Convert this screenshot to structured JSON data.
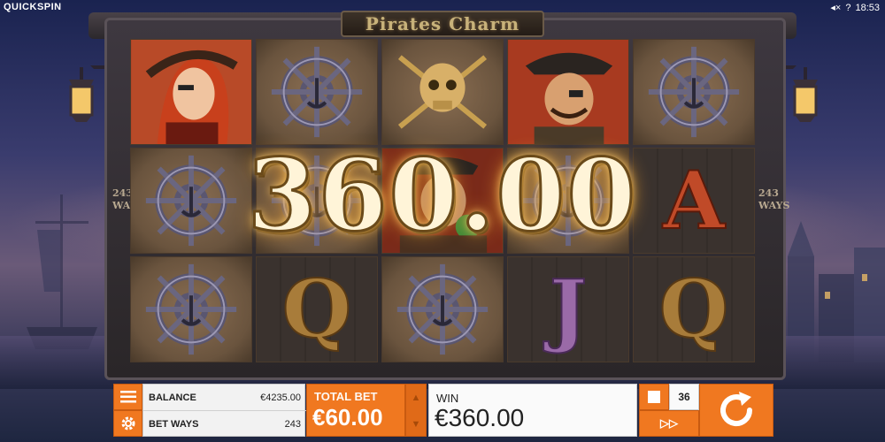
{
  "header": {
    "brand": "QUICKSPIN",
    "mute_icon": "speaker-mute-icon",
    "help": "?",
    "time": "18:53"
  },
  "game": {
    "title": "Pirates Charm",
    "ways_text": "243 WAYS",
    "big_win_amount": "360.00"
  },
  "reels": [
    [
      {
        "symbol": "pirate-lady"
      },
      {
        "symbol": "ship-wheel"
      },
      {
        "symbol": "ship-wheel"
      }
    ],
    [
      {
        "symbol": "ship-wheel"
      },
      {
        "symbol": "ship-wheel"
      },
      {
        "symbol": "Q"
      }
    ],
    [
      {
        "symbol": "skull-swords"
      },
      {
        "symbol": "pirate-parrot"
      },
      {
        "symbol": "ship-wheel"
      }
    ],
    [
      {
        "symbol": "pirate-captain"
      },
      {
        "symbol": "ship-wheel"
      },
      {
        "symbol": "J"
      }
    ],
    [
      {
        "symbol": "ship-wheel"
      },
      {
        "symbol": "A"
      },
      {
        "symbol": "Q"
      }
    ]
  ],
  "controls": {
    "menu_icon": "hamburger-menu-icon",
    "settings_icon": "gear-icon",
    "balance_label": "BALANCE",
    "balance_value": "€4235.00",
    "bet_ways_label": "BET WAYS",
    "bet_ways_value": "243",
    "total_bet_label": "TOTAL BET",
    "total_bet_value": "€60.00",
    "win_label": "WIN",
    "win_value": "€360.00",
    "autoplay_count": "36",
    "turbo_label": "▷▷"
  },
  "colors": {
    "accent": "#f07820",
    "panel": "#f2f2f2"
  }
}
